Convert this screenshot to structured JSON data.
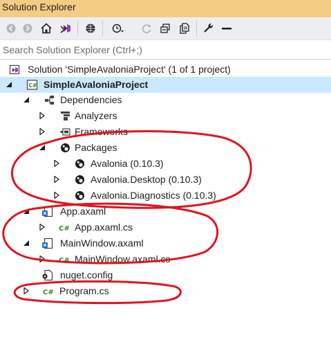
{
  "panel": {
    "title": "Solution Explorer"
  },
  "toolbar": {
    "buttons": [
      {
        "name": "back",
        "icon": "back-arrow-icon"
      },
      {
        "name": "forward",
        "icon": "forward-arrow-icon"
      },
      {
        "name": "home",
        "icon": "home-icon"
      },
      {
        "name": "switch-views",
        "icon": "vs-views-icon"
      },
      {
        "name": "pending-changes",
        "icon": "globe-filter-icon"
      },
      {
        "name": "history",
        "icon": "clock-dropdown-icon"
      },
      {
        "name": "sync",
        "icon": "refresh-icon"
      },
      {
        "name": "collapse-all",
        "icon": "collapse-all-icon"
      },
      {
        "name": "show-all-files",
        "icon": "copy-files-icon"
      },
      {
        "name": "properties",
        "icon": "wrench-icon"
      },
      {
        "name": "preview",
        "icon": "minus-icon"
      }
    ]
  },
  "search": {
    "placeholder": "Search Solution Explorer (Ctrl+;)"
  },
  "tree": {
    "solution": "Solution 'SimpleAvaloniaProject' (1 of 1 project)",
    "project": "SimpleAvaloniaProject",
    "dependencies": "Dependencies",
    "analyzers": "Analyzers",
    "frameworks": "Frameworks",
    "packages": "Packages",
    "pkg_avalonia": "Avalonia (0.10.3)",
    "pkg_desktop": "Avalonia.Desktop (0.10.3)",
    "pkg_diagnostics": "Avalonia.Diagnostics (0.10.3)",
    "app_axaml": "App.axaml",
    "app_axaml_cs": "App.axaml.cs",
    "mainwindow_axaml": "MainWindow.axaml",
    "mainwindow_axaml_cs": "MainWindow.axaml.cs",
    "nuget_config": "nuget.config",
    "program_cs": "Program.cs"
  },
  "colors": {
    "title_bar": "#f5cc84",
    "toolbar": "#eeeef2",
    "selection": "#cce8ff",
    "annotation": "#e0141e",
    "csharp_green": "#388a34"
  }
}
